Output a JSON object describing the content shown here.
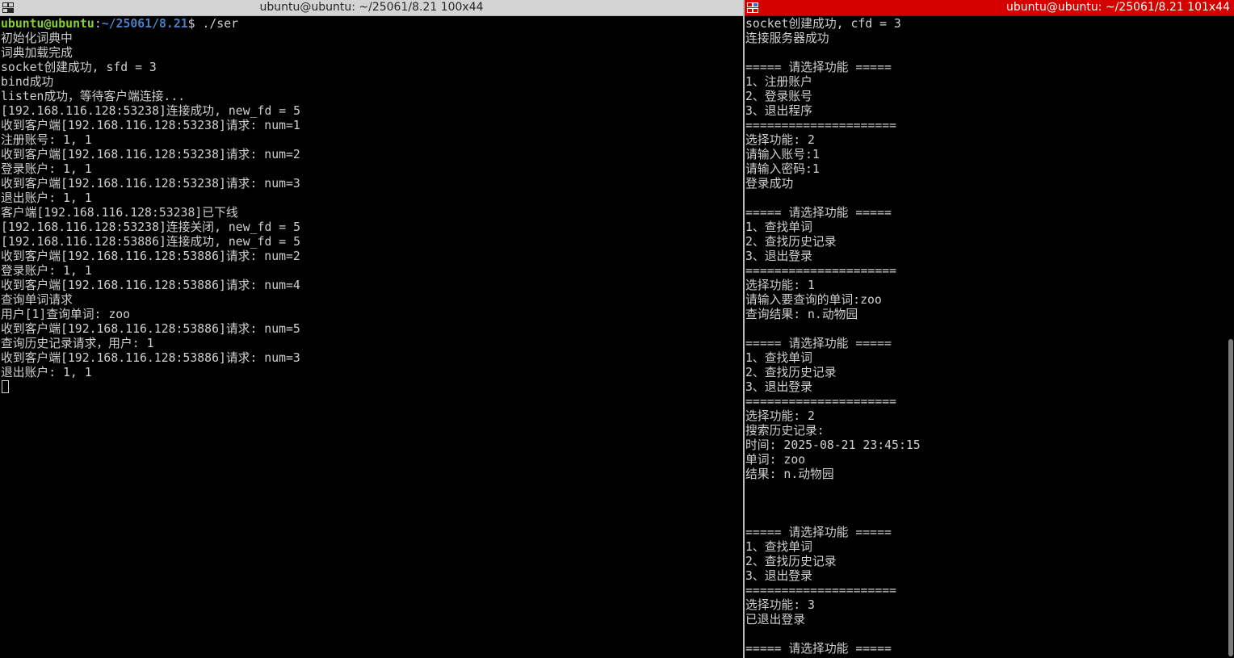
{
  "colors": {
    "prompt_user": "#89d033",
    "prompt_path": "#4d7fc0",
    "terminal_text": "#d0d0d0",
    "active_title_bg": "#d40000",
    "inactive_title_bg": "#d4d4d4"
  },
  "left_window": {
    "title": "ubuntu@ubuntu: ~/25061/8.21 100x44",
    "icon": "terminal-split-icon",
    "prompt": {
      "user": "ubuntu@ubuntu",
      "sep": ":",
      "path": "~/25061/8.21",
      "symbol": "$ ",
      "command": "./ser"
    },
    "lines": [
      "初始化词典中",
      "词典加载完成",
      "socket创建成功, sfd = 3",
      "bind成功",
      "listen成功，等待客户端连接...",
      "[192.168.116.128:53238]连接成功, new_fd = 5",
      "收到客户端[192.168.116.128:53238]请求: num=1",
      "注册账号: 1, 1",
      "收到客户端[192.168.116.128:53238]请求: num=2",
      "登录账户: 1, 1",
      "收到客户端[192.168.116.128:53238]请求: num=3",
      "退出账户: 1, 1",
      "客户端[192.168.116.128:53238]已下线",
      "[192.168.116.128:53238]连接关闭, new_fd = 5",
      "[192.168.116.128:53886]连接成功, new_fd = 5",
      "收到客户端[192.168.116.128:53886]请求: num=2",
      "登录账户: 1, 1",
      "收到客户端[192.168.116.128:53886]请求: num=4",
      "查询单词请求",
      "用户[1]查询单词: zoo",
      "收到客户端[192.168.116.128:53886]请求: num=5",
      "查询历史记录请求，用户: 1",
      "收到客户端[192.168.116.128:53886]请求: num=3",
      "退出账户: 1, 1"
    ]
  },
  "right_window": {
    "title": "ubuntu@ubuntu: ~/25061/8.21 101x44",
    "icon": "terminal-split-icon",
    "lines": [
      "socket创建成功, cfd = 3",
      "连接服务器成功",
      "",
      "===== 请选择功能 =====",
      "1、注册账户",
      "2、登录账号",
      "3、退出程序",
      "=====================",
      "选择功能: 2",
      "请输入账号:1",
      "请输入密码:1",
      "登录成功",
      "",
      "===== 请选择功能 =====",
      "1、查找单词",
      "2、查找历史记录",
      "3、退出登录",
      "=====================",
      "选择功能: 1",
      "请输入要查询的单词:zoo",
      "查询结果: n.动物园",
      "",
      "===== 请选择功能 =====",
      "1、查找单词",
      "2、查找历史记录",
      "3、退出登录",
      "=====================",
      "选择功能: 2",
      "搜索历史记录:",
      "时间: 2025-08-21 23:45:15",
      "单词: zoo",
      "结果: n.动物园",
      "",
      "",
      "",
      "===== 请选择功能 =====",
      "1、查找单词",
      "2、查找历史记录",
      "3、退出登录",
      "=====================",
      "选择功能: 3",
      "已退出登录",
      "",
      "===== 请选择功能 ====="
    ]
  }
}
